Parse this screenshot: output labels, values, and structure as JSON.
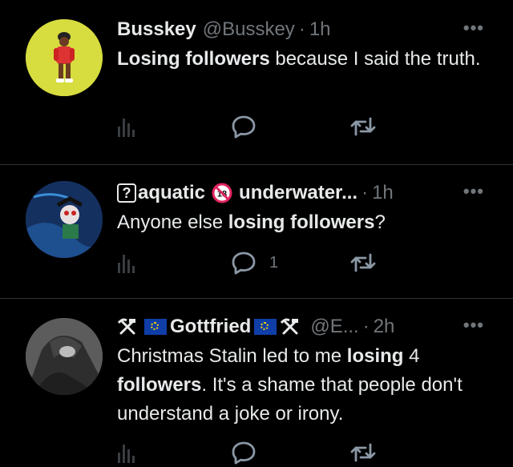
{
  "tweets": [
    {
      "name": "Busskey",
      "handle": "@Busskey",
      "dot": "·",
      "time": "1h",
      "more": "•••",
      "text_parts": [
        {
          "bold": true,
          "text": "Losing followers"
        },
        {
          "bold": false,
          "text": " because I said the truth."
        }
      ],
      "reply_count": "",
      "avatar_bg": "#d7dc3f"
    },
    {
      "name_prefix_badge": "?",
      "name": "aquatic",
      "name_suffix": "underwater...",
      "dot": "·",
      "time": "1h",
      "more": "•••",
      "text_parts": [
        {
          "bold": false,
          "text": "Anyone else "
        },
        {
          "bold": true,
          "text": "losing followers"
        },
        {
          "bold": false,
          "text": "?"
        }
      ],
      "reply_count": "1",
      "avatar_bg": "#1a3a6e"
    },
    {
      "name": "Gottfried",
      "handle": "@E...",
      "dot": "·",
      "time": "2h",
      "more": "•••",
      "text_parts": [
        {
          "bold": false,
          "text": "Christmas Stalin led to me "
        },
        {
          "bold": true,
          "text": "losing"
        },
        {
          "bold": false,
          "text": " 4 "
        },
        {
          "bold": true,
          "text": "followers"
        },
        {
          "bold": false,
          "text": ". It's a shame that people don't understand a joke or irony."
        }
      ],
      "reply_count": "",
      "avatar_bg": "#6d6d6d"
    }
  ],
  "colors": {
    "background": "#000000",
    "text": "#e7e9ea",
    "muted": "#71767b",
    "divider": "#2f3336"
  }
}
